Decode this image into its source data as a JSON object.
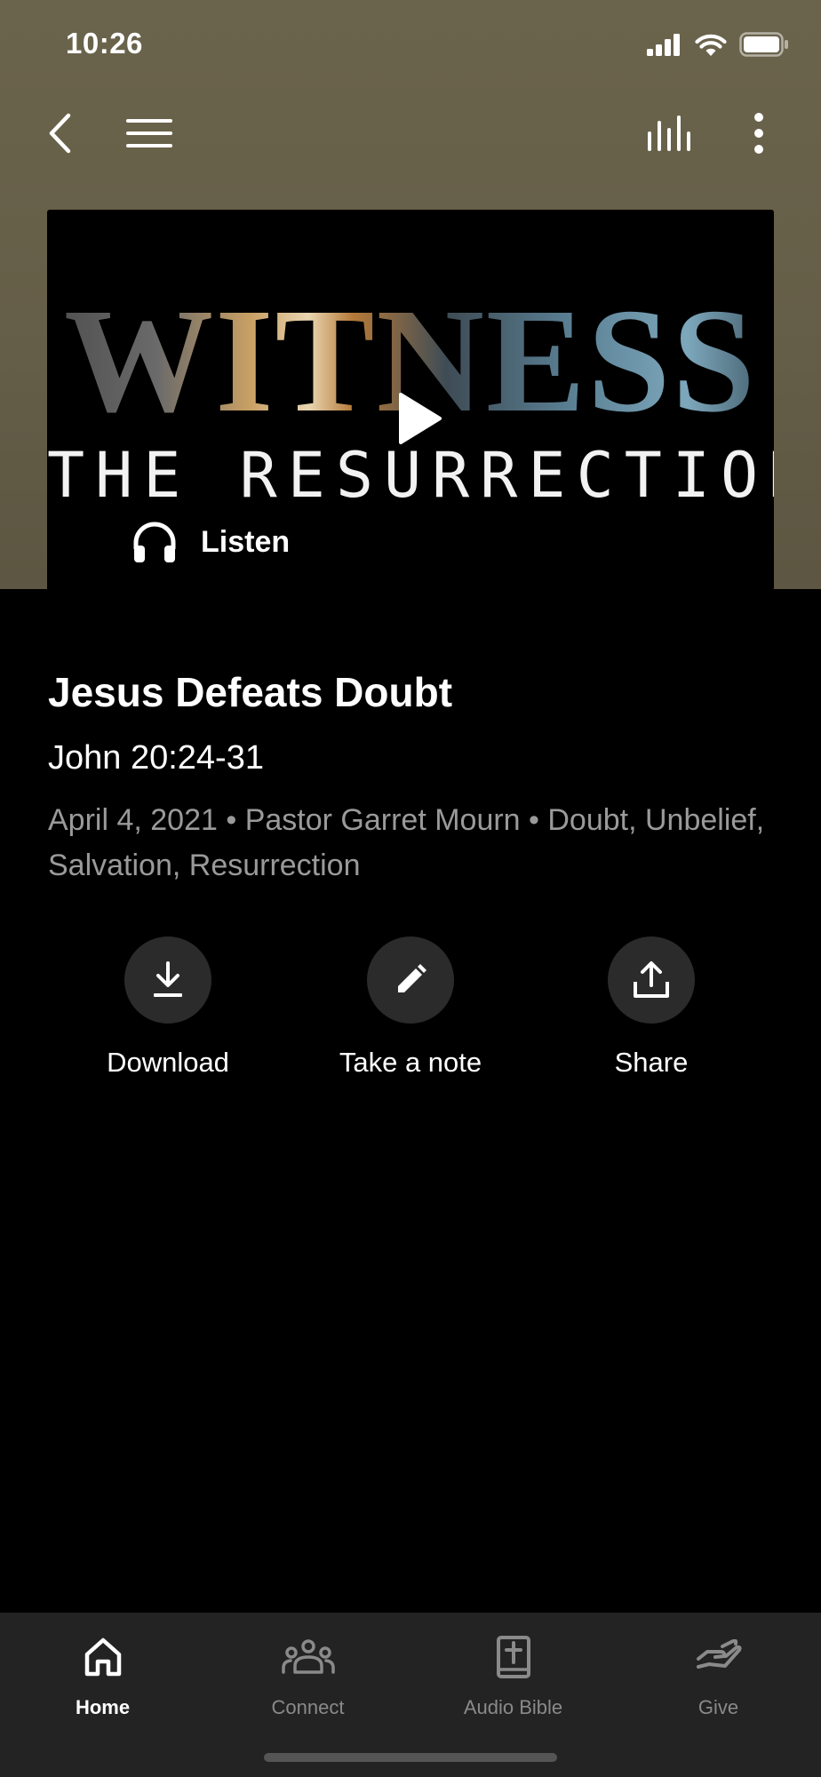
{
  "status_bar": {
    "time": "10:26"
  },
  "header": {
    "back_icon": "chevron-left-icon",
    "menu_icon": "hamburger-menu-icon",
    "audio_bars_icon": "audio-bars-icon",
    "more_icon": "vertical-dots-icon"
  },
  "artwork": {
    "title_text": "WITNESS",
    "subtitle_text": "THE RESURRECTION",
    "listen_label": "Listen"
  },
  "sermon": {
    "title": "Jesus Defeats Doubt",
    "scripture": "John 20:24-31",
    "meta": "April 4, 2021 • Pastor Garret Mourn • Doubt, Unbelief, Salvation, Resurrection"
  },
  "actions": [
    {
      "label": "Download",
      "icon": "download-icon"
    },
    {
      "label": "Take a note",
      "icon": "pencil-icon"
    },
    {
      "label": "Share",
      "icon": "share-icon"
    }
  ],
  "bottom_nav": [
    {
      "label": "Home",
      "icon": "home-icon",
      "active": true
    },
    {
      "label": "Connect",
      "icon": "people-icon",
      "active": false
    },
    {
      "label": "Audio Bible",
      "icon": "bible-icon",
      "active": false
    },
    {
      "label": "Give",
      "icon": "give-hand-icon",
      "active": false
    }
  ],
  "colors": {
    "header_bg": "#68614a",
    "page_bg": "#000000",
    "meta_text": "#9a9a9a",
    "action_circle": "#2b2b2b",
    "nav_bg": "#232323",
    "nav_inactive": "#8a8a8a"
  }
}
